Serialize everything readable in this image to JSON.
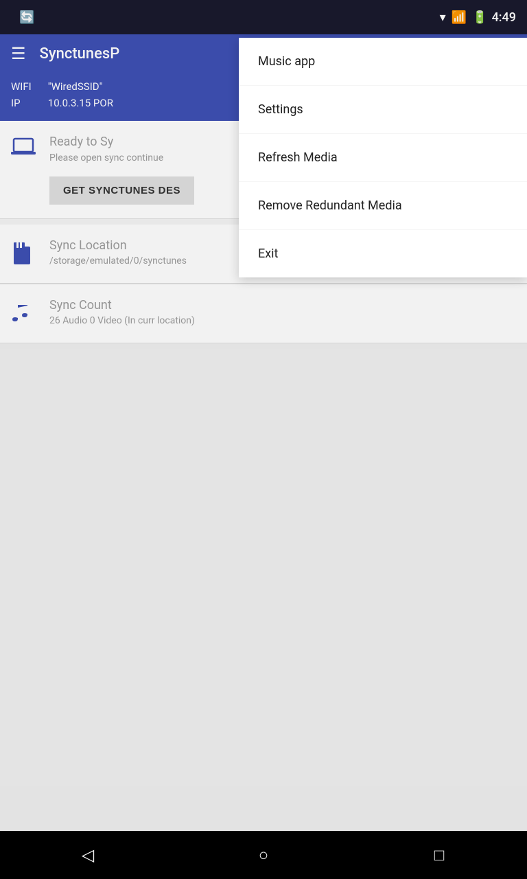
{
  "statusBar": {
    "time": "4:49",
    "icons": [
      "wifi",
      "signal",
      "battery"
    ]
  },
  "appBar": {
    "title": "SynctunesP",
    "hamburger": "☰"
  },
  "infoBar": {
    "labels": [
      "WIFI",
      "IP"
    ],
    "values": [
      "\"WiredSSID\"",
      "10.0.3.15    POR"
    ]
  },
  "mainCard": {
    "icon": "💻",
    "title": "Ready to Sy",
    "desc": "Please open sync\ncontinue",
    "buttonLabel": "GET SYNCTUNES DES"
  },
  "syncLocation": {
    "icon": "📋",
    "title": "Sync Location",
    "path": "/storage/emulated/0/synctunes"
  },
  "syncCount": {
    "icon": "♪",
    "title": "Sync Count",
    "desc": "26 Audio 0 Video (In curr location)"
  },
  "dropdownMenu": {
    "items": [
      {
        "id": "music-app",
        "label": "Music app"
      },
      {
        "id": "settings",
        "label": "Settings"
      },
      {
        "id": "refresh-media",
        "label": "Refresh Media"
      },
      {
        "id": "remove-redundant",
        "label": "Remove Redundant Media"
      },
      {
        "id": "exit",
        "label": "Exit"
      }
    ]
  },
  "bottomNav": {
    "back": "◁",
    "home": "○",
    "recent": "□"
  }
}
